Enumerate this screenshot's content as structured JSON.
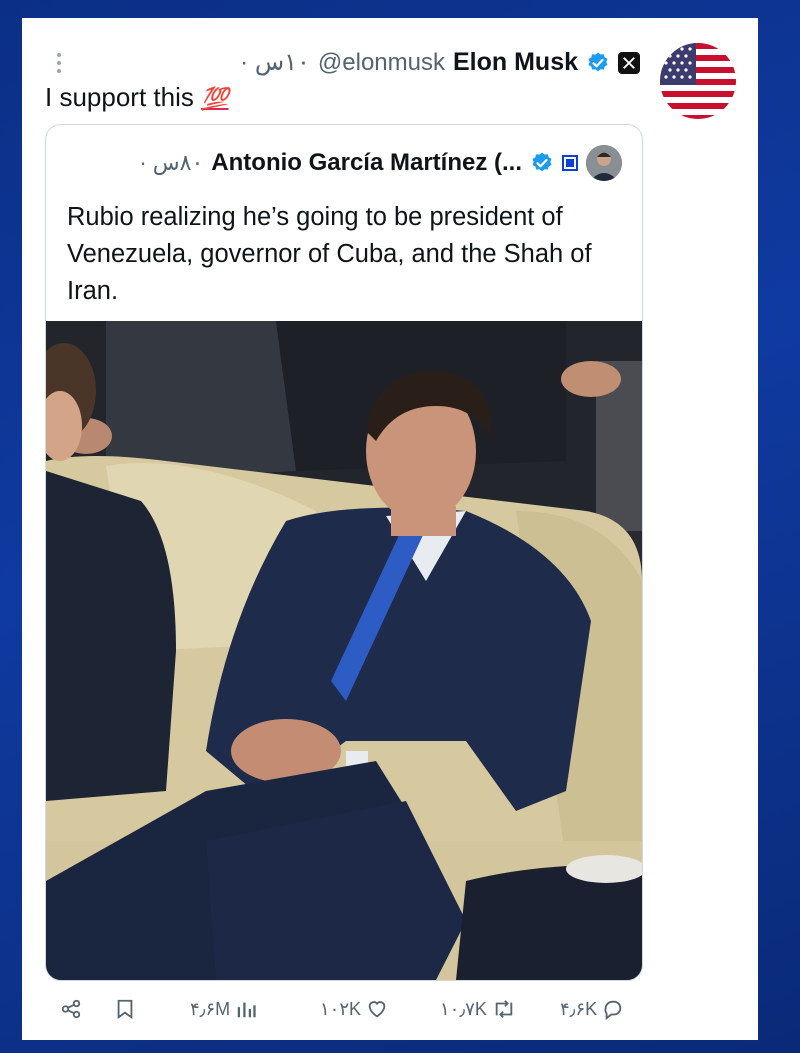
{
  "tweet": {
    "author_name": "Elon Musk",
    "handle": "@elonmusk",
    "time": "۱۰س ·",
    "text": "I support this",
    "emoji": "💯"
  },
  "quote": {
    "author_name": "Antonio García Martínez (...",
    "time": "۸۰س ·",
    "text": "Rubio realizing he’s going to be president of Venezuela, governor of Cuba, and the Shah of Iran."
  },
  "actions": {
    "views": "۴٫۶M",
    "likes": "۱۰۲K",
    "reposts": "۱۰٫۷K",
    "replies": "۴٫۶K"
  },
  "icons": {
    "verified": "verified-badge-icon",
    "x_logo": "x-logo-icon",
    "flag": "us-flag-icon",
    "share": "share-icon",
    "bookmark": "bookmark-icon",
    "views": "views-chart-icon",
    "like": "heart-icon",
    "repost": "repost-icon",
    "reply": "reply-icon"
  },
  "colors": {
    "verified_blue": "#1d9bf0",
    "background_blue": "#0f3aa0",
    "muted_text": "#536471"
  }
}
